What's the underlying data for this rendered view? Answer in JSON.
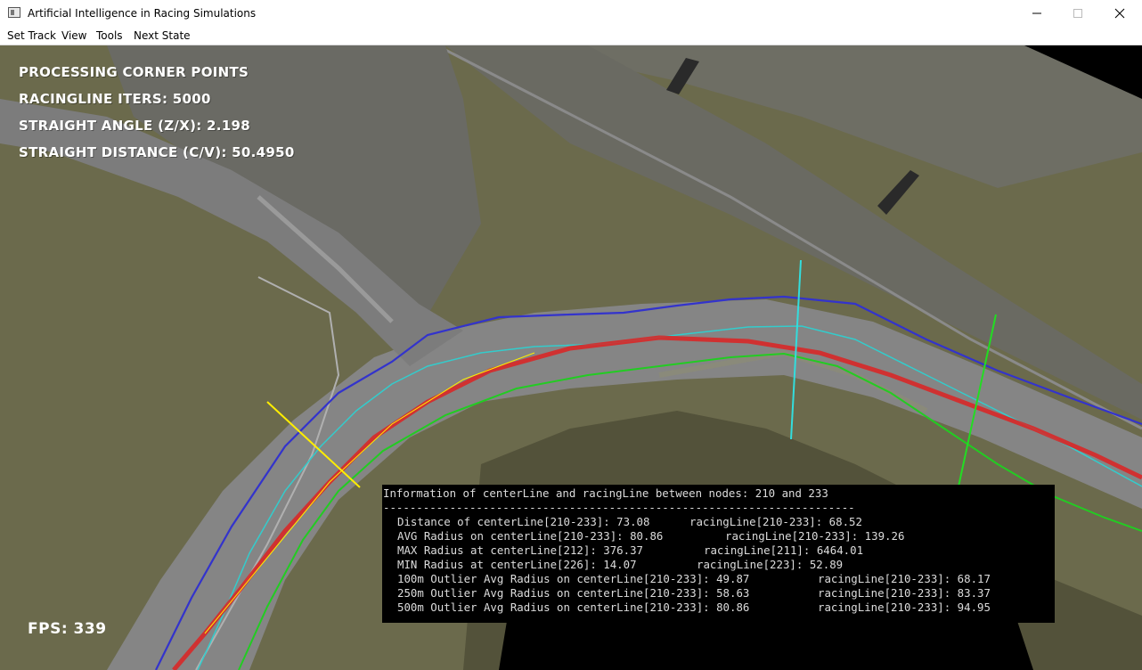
{
  "window": {
    "title": "Artificial Intelligence in Racing Simulations",
    "minimize_icon": "minimize-icon",
    "maximize_icon": "maximize-icon",
    "close_icon": "close-icon"
  },
  "menu": {
    "items": [
      {
        "label": "Set Track"
      },
      {
        "label": "View"
      },
      {
        "label": "Tools"
      },
      {
        "label": "Next State"
      }
    ]
  },
  "hud": {
    "status": "PROCESSING CORNER POINTS",
    "racingline_iters": "RACINGLINE ITERS: 5000",
    "straight_angle": "STRAIGHT ANGLE (Z/X): 2.198",
    "straight_distance": "STRAIGHT DISTANCE (C/V): 50.4950",
    "fps": "FPS: 339"
  },
  "info": {
    "header": "Information of centerLine and racingLine between nodes: 210 and 233",
    "separator": "-----------------------------------------------------------------------",
    "distance_center": "Distance of centerLine[210-233]: 73.08",
    "distance_racing": "racingLine[210-233]: 68.52",
    "avg_center": "AVG Radius on centerLine[210-233]: 80.86",
    "avg_racing": "racingLine[210-233]: 139.26",
    "max_center": "MAX Radius at centerLine[212]: 376.37",
    "max_racing": "racingLine[211]: 6464.01",
    "min_center": "MIN Radius at centerLine[226]: 14.07",
    "min_racing": "racingLine[223]: 52.89",
    "out100_center": "100m Outlier Avg Radius on centerLine[210-233]: 49.87",
    "out100_racing": "racingLine[210-233]: 68.17",
    "out250_center": "250m Outlier Avg Radius on centerLine[210-233]: 58.63",
    "out250_racing": "racingLine[210-233]: 83.37",
    "out500_center": "500m Outlier Avg Radius on centerLine[210-233]: 80.86",
    "out500_racing": "racingLine[210-233]: 94.95"
  },
  "colors": {
    "terrain": "#6b6a4c",
    "road": "#808080",
    "boundary_line": "#3333cc",
    "center_line": "#33cccc",
    "racing_line": "#dd2222",
    "inner_line": "#22cc22",
    "marker_yellow": "#ffee00"
  }
}
